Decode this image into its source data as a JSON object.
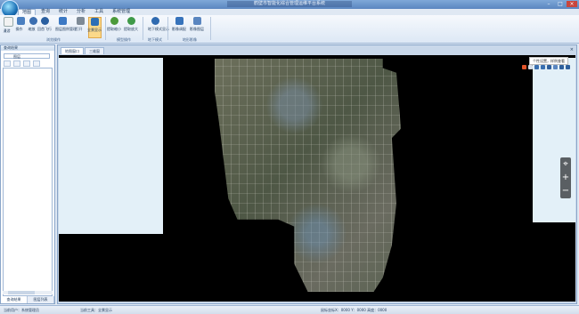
{
  "titlebar": {
    "title": "鹤壁市智能化综合管理运维平台系统",
    "minimize": "–",
    "maximize": "□",
    "close": "×"
  },
  "menu": [
    "地图",
    "查询",
    "统计",
    "分析",
    "工具",
    "系统管理"
  ],
  "ribbon": {
    "buttons": [
      "漫游",
      "操作",
      "缩放",
      "回首飞行",
      "图层图例管理",
      "打开",
      "全景显示",
      "提取缩小",
      "提取放大",
      "地下模式显示",
      "影像调配",
      "影像图层"
    ],
    "groups": [
      "浏览操作",
      "模型操作",
      "地下模式",
      "地形影像"
    ]
  },
  "left_panel": {
    "title": "查询结果",
    "combo": "图层",
    "tabs": [
      "查询结果",
      "图层列表"
    ]
  },
  "doc": {
    "tabs": [
      "地图窗口",
      "三维窗"
    ],
    "close": "×",
    "tooltip": "个性设置，样例查看"
  },
  "zoom": {
    "locate": "⌖",
    "plus": "+",
    "minus": "−"
  },
  "status": {
    "user": "当前用户：系统管理员",
    "mode": "当前工具：全景显示",
    "coords": "鼠标坐标X：0000    Y：0000    高度：0000"
  },
  "colors": {
    "accent": "#1e395b",
    "ribbon_bg": "#dde8f5",
    "map_bg": "#000000"
  }
}
